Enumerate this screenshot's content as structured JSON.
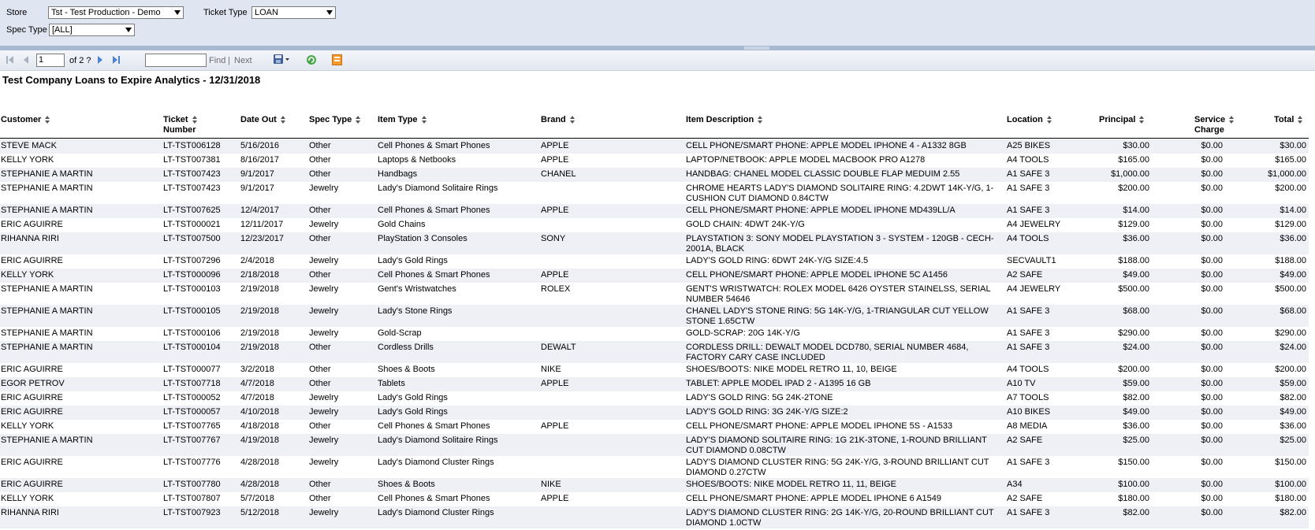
{
  "params": {
    "store_label": "Store",
    "store_value": "Tst - Test Production - Demo",
    "ticket_type_label": "Ticket Type",
    "ticket_type_value": "LOAN",
    "spec_type_label": "Spec Type",
    "spec_type_value": "[ALL]"
  },
  "toolbar": {
    "page_number": "1",
    "page_of": "of 2 ?",
    "find_label": "Find",
    "separator": "|",
    "next_label": "Next",
    "icons": [
      "first-page-icon",
      "previous-page-icon",
      "next-page-icon",
      "last-page-icon",
      "export-icon",
      "refresh-icon",
      "print-icon"
    ]
  },
  "report": {
    "title": "Test Company Loans to Expire Analytics - 12/31/2018",
    "columns": {
      "customer": "Customer",
      "ticket_number_1": "Ticket",
      "ticket_number_2": "Number",
      "date_out": "Date Out",
      "spec_type": "Spec Type",
      "item_type": "Item Type",
      "brand": "Brand",
      "item_description": "Item Description",
      "location": "Location",
      "principal": "Principal",
      "service_charge_1": "Service",
      "service_charge_2": "Charge",
      "total": "Total"
    },
    "rows": [
      {
        "customer": "STEVE MACK",
        "ticket": "LT-TST006128",
        "date": "5/16/2016",
        "spec": "Other",
        "item": "Cell Phones & Smart Phones",
        "brand": "APPLE",
        "desc": "CELL PHONE/SMART PHONE: APPLE MODEL IPHONE 4 - A1332 8GB",
        "loc": "A25 BIKES",
        "principal": "$30.00",
        "service": "$0.00",
        "total": "$30.00"
      },
      {
        "customer": "KELLY YORK",
        "ticket": "LT-TST007381",
        "date": "8/16/2017",
        "spec": "Other",
        "item": "Laptops & Netbooks",
        "brand": "APPLE",
        "desc": "LAPTOP/NETBOOK: APPLE MODEL MACBOOK PRO A1278",
        "loc": "A4 TOOLS",
        "principal": "$165.00",
        "service": "$0.00",
        "total": "$165.00"
      },
      {
        "customer": "STEPHANIE A MARTIN",
        "ticket": "LT-TST007423",
        "date": "9/1/2017",
        "spec": "Other",
        "item": "Handbags",
        "brand": "CHANEL",
        "desc": "HANDBAG: CHANEL MODEL CLASSIC DOUBLE FLAP MEDUIM 2.55",
        "loc": "A1 SAFE 3",
        "principal": "$1,000.00",
        "service": "$0.00",
        "total": "$1,000.00"
      },
      {
        "customer": "STEPHANIE A MARTIN",
        "ticket": "LT-TST007423",
        "date": "9/1/2017",
        "spec": "Jewelry",
        "item": "Lady's Diamond Solitaire Rings",
        "brand": "",
        "desc": "CHROME HEARTS LADY'S DIAMOND SOLITAIRE RING: 4.2DWT 14K-Y/G, 1-CUSHION CUT DIAMOND 0.84CTW",
        "loc": "A1 SAFE 3",
        "principal": "$200.00",
        "service": "$0.00",
        "total": "$200.00"
      },
      {
        "customer": "STEPHANIE A MARTIN",
        "ticket": "LT-TST007625",
        "date": "12/4/2017",
        "spec": "Other",
        "item": "Cell Phones & Smart Phones",
        "brand": "APPLE",
        "desc": "CELL PHONE/SMART PHONE: APPLE MODEL IPHONE MD439LL/A",
        "loc": "A1 SAFE 3",
        "principal": "$14.00",
        "service": "$0.00",
        "total": "$14.00"
      },
      {
        "customer": "ERIC AGUIRRE",
        "ticket": "LT-TST000021",
        "date": "12/11/2017",
        "spec": "Jewelry",
        "item": "Gold Chains",
        "brand": "",
        "desc": "GOLD CHAIN: 4DWT 24K-Y/G",
        "loc": "A4 JEWELRY",
        "principal": "$129.00",
        "service": "$0.00",
        "total": "$129.00"
      },
      {
        "customer": "RIHANNA RIRI",
        "ticket": "LT-TST007500",
        "date": "12/23/2017",
        "spec": "Other",
        "item": "PlayStation 3 Consoles",
        "brand": "SONY",
        "desc": "PLAYSTATION 3: SONY MODEL PLAYSTATION 3 - SYSTEM - 120GB - CECH-2001A, BLACK",
        "loc": "A4 TOOLS",
        "principal": "$36.00",
        "service": "$0.00",
        "total": "$36.00"
      },
      {
        "customer": "ERIC AGUIRRE",
        "ticket": "LT-TST007296",
        "date": "2/4/2018",
        "spec": "Jewelry",
        "item": "Lady's Gold Rings",
        "brand": "",
        "desc": "LADY'S GOLD RING: 6DWT 24K-Y/G SIZE:4.5",
        "loc": "SECVAULT1",
        "principal": "$188.00",
        "service": "$0.00",
        "total": "$188.00"
      },
      {
        "customer": "KELLY YORK",
        "ticket": "LT-TST000096",
        "date": "2/18/2018",
        "spec": "Other",
        "item": "Cell Phones & Smart Phones",
        "brand": "APPLE",
        "desc": "CELL PHONE/SMART PHONE: APPLE MODEL IPHONE 5C A1456",
        "loc": "A2 SAFE",
        "principal": "$49.00",
        "service": "$0.00",
        "total": "$49.00"
      },
      {
        "customer": "STEPHANIE A MARTIN",
        "ticket": "LT-TST000103",
        "date": "2/19/2018",
        "spec": "Jewelry",
        "item": "Gent's Wristwatches",
        "brand": "ROLEX",
        "desc": "GENT'S WRISTWATCH: ROLEX MODEL 6426 OYSTER STAINELSS, SERIAL NUMBER 54646",
        "loc": "A4 JEWELRY",
        "principal": "$500.00",
        "service": "$0.00",
        "total": "$500.00"
      },
      {
        "customer": "STEPHANIE A MARTIN",
        "ticket": "LT-TST000105",
        "date": "2/19/2018",
        "spec": "Jewelry",
        "item": "Lady's Stone Rings",
        "brand": "",
        "desc": "CHANEL LADY'S STONE RING: 5G 14K-Y/G, 1-TRIANGULAR CUT YELLOW STONE 1.65CTW",
        "loc": "A1 SAFE 3",
        "principal": "$68.00",
        "service": "$0.00",
        "total": "$68.00"
      },
      {
        "customer": "STEPHANIE A MARTIN",
        "ticket": "LT-TST000106",
        "date": "2/19/2018",
        "spec": "Jewelry",
        "item": "Gold-Scrap",
        "brand": "",
        "desc": "GOLD-SCRAP: 20G 14K-Y/G",
        "loc": "A1 SAFE 3",
        "principal": "$290.00",
        "service": "$0.00",
        "total": "$290.00"
      },
      {
        "customer": "STEPHANIE A MARTIN",
        "ticket": "LT-TST000104",
        "date": "2/19/2018",
        "spec": "Other",
        "item": "Cordless Drills",
        "brand": "DEWALT",
        "desc": "CORDLESS DRILL: DEWALT MODEL DCD780, SERIAL NUMBER 4684, FACTORY CARY CASE INCLUDED",
        "loc": "A1 SAFE 3",
        "principal": "$24.00",
        "service": "$0.00",
        "total": "$24.00"
      },
      {
        "customer": "ERIC AGUIRRE",
        "ticket": "LT-TST000077",
        "date": "3/2/2018",
        "spec": "Other",
        "item": "Shoes & Boots",
        "brand": "NIKE",
        "desc": "SHOES/BOOTS: NIKE MODEL RETRO 11, 10, BEIGE",
        "loc": "A4 TOOLS",
        "principal": "$200.00",
        "service": "$0.00",
        "total": "$200.00"
      },
      {
        "customer": "EGOR PETROV",
        "ticket": "LT-TST007718",
        "date": "4/7/2018",
        "spec": "Other",
        "item": "Tablets",
        "brand": "APPLE",
        "desc": "TABLET: APPLE MODEL IPAD 2 - A1395 16 GB",
        "loc": "A10 TV",
        "principal": "$59.00",
        "service": "$0.00",
        "total": "$59.00"
      },
      {
        "customer": "ERIC AGUIRRE",
        "ticket": "LT-TST000052",
        "date": "4/7/2018",
        "spec": "Jewelry",
        "item": "Lady's Gold Rings",
        "brand": "",
        "desc": "LADY'S GOLD RING: 5G 24K-2TONE",
        "loc": "A7 TOOLS",
        "principal": "$82.00",
        "service": "$0.00",
        "total": "$82.00"
      },
      {
        "customer": "ERIC AGUIRRE",
        "ticket": "LT-TST000057",
        "date": "4/10/2018",
        "spec": "Jewelry",
        "item": "Lady's Gold Rings",
        "brand": "",
        "desc": "LADY'S GOLD RING: 3G 24K-Y/G SIZE:2",
        "loc": "A10 BIKES",
        "principal": "$49.00",
        "service": "$0.00",
        "total": "$49.00"
      },
      {
        "customer": "KELLY YORK",
        "ticket": "LT-TST007765",
        "date": "4/18/2018",
        "spec": "Other",
        "item": "Cell Phones & Smart Phones",
        "brand": "APPLE",
        "desc": "CELL PHONE/SMART PHONE: APPLE MODEL IPHONE 5S - A1533",
        "loc": "A8 MEDIA",
        "principal": "$36.00",
        "service": "$0.00",
        "total": "$36.00"
      },
      {
        "customer": "STEPHANIE A MARTIN",
        "ticket": "LT-TST007767",
        "date": "4/19/2018",
        "spec": "Jewelry",
        "item": "Lady's Diamond Solitaire Rings",
        "brand": "",
        "desc": "LADY'S DIAMOND SOLITAIRE RING: 1G 21K-3TONE, 1-ROUND BRILLIANT CUT DIAMOND 0.08CTW",
        "loc": "A2 SAFE",
        "principal": "$25.00",
        "service": "$0.00",
        "total": "$25.00"
      },
      {
        "customer": "ERIC AGUIRRE",
        "ticket": "LT-TST007776",
        "date": "4/28/2018",
        "spec": "Jewelry",
        "item": "Lady's Diamond Cluster Rings",
        "brand": "",
        "desc": "LADY'S DIAMOND CLUSTER RING: 5G 24K-Y/G, 3-ROUND BRILLIANT CUT DIAMOND 0.27CTW",
        "loc": "A1 SAFE 3",
        "principal": "$150.00",
        "service": "$0.00",
        "total": "$150.00"
      },
      {
        "customer": "ERIC AGUIRRE",
        "ticket": "LT-TST007780",
        "date": "4/28/2018",
        "spec": "Other",
        "item": "Shoes & Boots",
        "brand": "NIKE",
        "desc": "SHOES/BOOTS: NIKE MODEL RETRO 11, 11, BEIGE",
        "loc": "A34",
        "principal": "$100.00",
        "service": "$0.00",
        "total": "$100.00"
      },
      {
        "customer": "KELLY YORK",
        "ticket": "LT-TST007807",
        "date": "5/7/2018",
        "spec": "Other",
        "item": "Cell Phones & Smart Phones",
        "brand": "APPLE",
        "desc": "CELL PHONE/SMART PHONE: APPLE MODEL IPHONE 6 A1549",
        "loc": "A2 SAFE",
        "principal": "$180.00",
        "service": "$0.00",
        "total": "$180.00"
      },
      {
        "customer": "RIHANNA RIRI",
        "ticket": "LT-TST007923",
        "date": "5/12/2018",
        "spec": "Jewelry",
        "item": "Lady's Diamond Cluster Rings",
        "brand": "",
        "desc": "LADY'S DIAMOND CLUSTER RING: 2G 14K-Y/G, 20-ROUND BRILLIANT CUT DIAMOND 1.0CTW",
        "loc": "A1 SAFE 3",
        "principal": "$82.00",
        "service": "$0.00",
        "total": "$82.00"
      }
    ]
  },
  "colors": {
    "panel": "#dfe5f1",
    "splitter": "#a8b8d0",
    "row_alt": "#eef0f6",
    "nav_blue": "#4a83d1"
  }
}
